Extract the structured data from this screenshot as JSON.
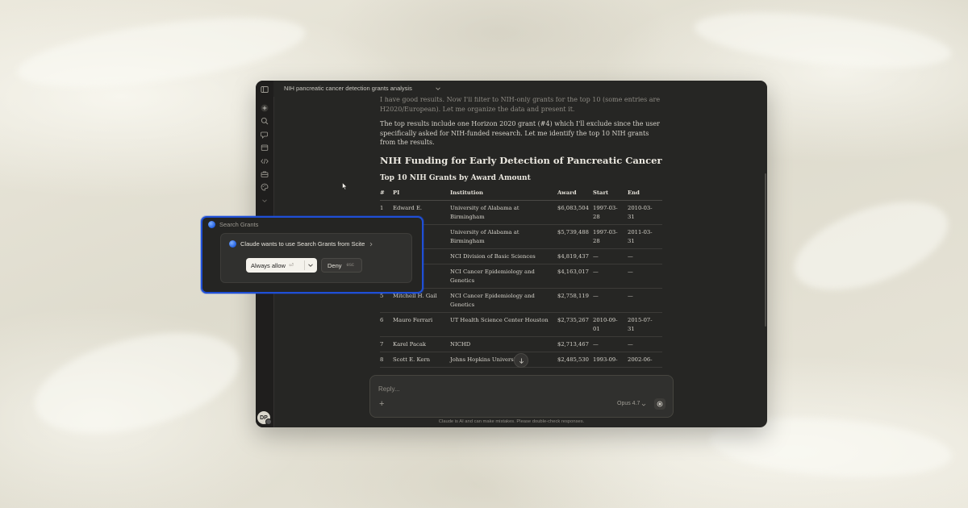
{
  "window": {
    "title": "NIH pancreatic cancer detection grants analysis"
  },
  "sidebar": {
    "icons": [
      "sidebar-toggle-icon",
      "new-chat-icon",
      "search-icon",
      "chats-icon",
      "projects-icon",
      "code-icon",
      "briefcase-icon",
      "palette-icon",
      "chevron-down-icon"
    ],
    "avatar_initials": "DP"
  },
  "conversation": {
    "para_faded": "I have good results. Now I'll filter to NIH-only grants for the top 10 (some entries are H2020/European). Let me organize the data and present it.",
    "para_1": "The top results include one Horizon 2020 grant (#4) which I'll exclude since the user specifically asked for NIH-funded research. Let me identify the top 10 NIH grants from the results.",
    "heading": "NIH Funding for Early Detection of Pancreatic Cancer",
    "subheading": "Top 10 NIH Grants by Award Amount"
  },
  "table": {
    "columns": [
      "#",
      "PI",
      "Institution",
      "Award",
      "Start",
      "End"
    ],
    "rows": [
      [
        "1",
        "Edward E.",
        "University of Alabama at Birmingham",
        "$6,083,504",
        "1997-03-28",
        "2010-03-31"
      ],
      [
        "2",
        "",
        "University of Alabama at Birmingham",
        "$5,739,488",
        "1997-03-28",
        "2011-03-31"
      ],
      [
        "3",
        "",
        "NCI Division of Basic Sciences",
        "$4,819,437",
        "—",
        "—"
      ],
      [
        "4",
        "",
        "NCI Cancer Epidemiology and Genetics",
        "$4,163,017",
        "—",
        "—"
      ],
      [
        "5",
        "Mitchell H. Gail",
        "NCI Cancer Epidemiology and Genetics",
        "$2,758,119",
        "—",
        "—"
      ],
      [
        "6",
        "Mauro Ferrari",
        "UT Health Science Center Houston",
        "$2,735,267",
        "2010-09-01",
        "2015-07-31"
      ],
      [
        "7",
        "Karel Pacak",
        "NICHD",
        "$2,713,467",
        "—",
        "—"
      ],
      [
        "8",
        "Scott E. Kern",
        "Johns Hopkins University",
        "$2,485,530",
        "1993-09-",
        "2002-06-"
      ]
    ]
  },
  "composer": {
    "placeholder": "Reply...",
    "model": "Opus 4.7",
    "disclaimer": "Claude is AI and can make mistakes. Please double-check responses."
  },
  "permission": {
    "tool_name": "Search Grants",
    "request_text": "Claude wants to use Search Grants from Scite",
    "allow_label": "Always allow",
    "allow_shortcut": "⏎",
    "deny_label": "Deny",
    "deny_shortcut": "esc",
    "border_color": "#1f4fd6"
  }
}
